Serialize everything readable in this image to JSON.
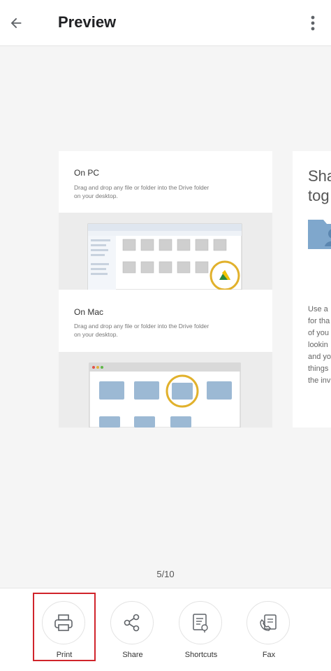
{
  "header": {
    "title": "Preview"
  },
  "page": {
    "pc_title": "On PC",
    "pc_desc": "Drag and drop any file or folder into the Drive folder on your desktop.",
    "mac_title": "On Mac",
    "mac_desc": "Drag and drop any file or folder into the Drive folder on your desktop."
  },
  "next_page": {
    "heading_lines": [
      "Sha",
      "tog"
    ],
    "body_lines": [
      "Use a",
      "for tha",
      "of you",
      "lookin",
      "and yo",
      "things",
      "the inv"
    ]
  },
  "page_counter": "5/10",
  "actions": [
    {
      "label": "Print",
      "icon": "printer-icon"
    },
    {
      "label": "Share",
      "icon": "share-icon"
    },
    {
      "label": "Shortcuts",
      "icon": "shortcuts-icon"
    },
    {
      "label": "Fax",
      "icon": "fax-icon"
    }
  ],
  "colors": {
    "highlight": "#d0242b",
    "drive_circle": "#e1b12c",
    "folder": "#9cb9d4"
  }
}
